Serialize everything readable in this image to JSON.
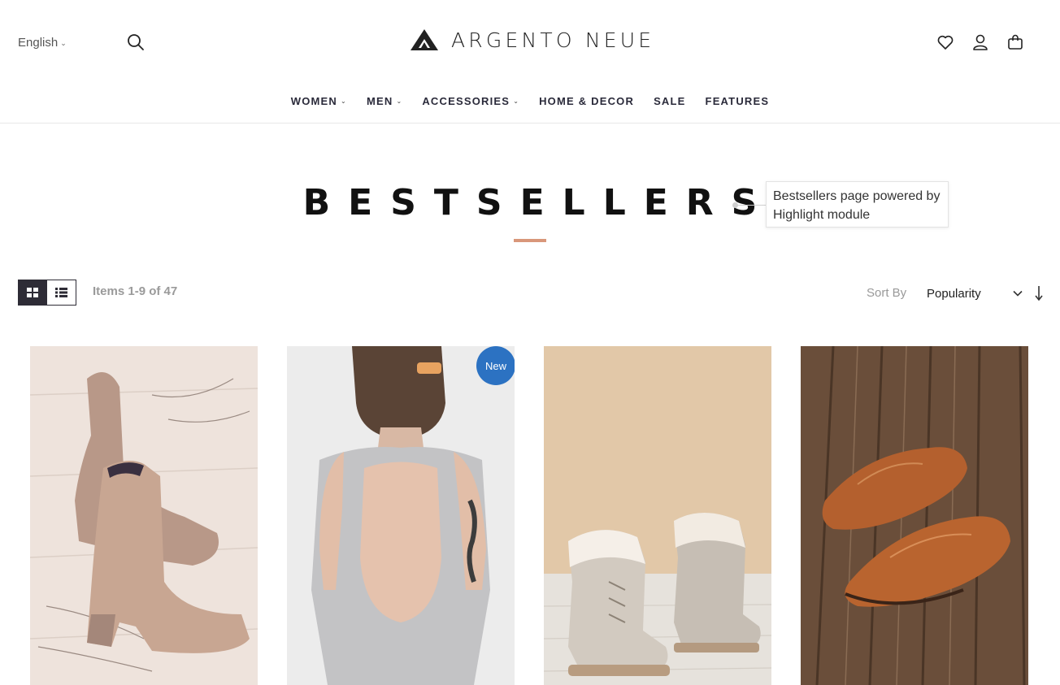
{
  "header": {
    "language": "English",
    "logo_text": "ARGENTO NEUE",
    "icons": [
      "search-icon",
      "heart-icon",
      "user-icon",
      "bag-icon"
    ]
  },
  "nav": {
    "items": [
      {
        "label": "WOMEN",
        "dropdown": true
      },
      {
        "label": "MEN",
        "dropdown": true
      },
      {
        "label": "ACCESSORIES",
        "dropdown": true
      },
      {
        "label": "HOME & DECOR",
        "dropdown": false
      },
      {
        "label": "SALE",
        "dropdown": false
      },
      {
        "label": "FEATURES",
        "dropdown": false
      }
    ]
  },
  "page": {
    "title": "BESTSELLERS",
    "tooltip": "Bestsellers page powered by Highlight module"
  },
  "toolbar": {
    "items_count": "Items 1-9 of 47",
    "sort_label": "Sort By",
    "sort_value": "Popularity",
    "active_view": "grid"
  },
  "products": [
    {
      "image": "tan-suede-ankle-boots",
      "badge": ""
    },
    {
      "image": "gray-open-back-jumpsuit",
      "badge": "New"
    },
    {
      "image": "beige-fur-lined-boots",
      "badge": ""
    },
    {
      "image": "brown-leather-loafers",
      "badge": ""
    }
  ],
  "colors": {
    "accent": "#d9977a",
    "badge": "#2c72c2",
    "dark": "#2e2c36"
  }
}
